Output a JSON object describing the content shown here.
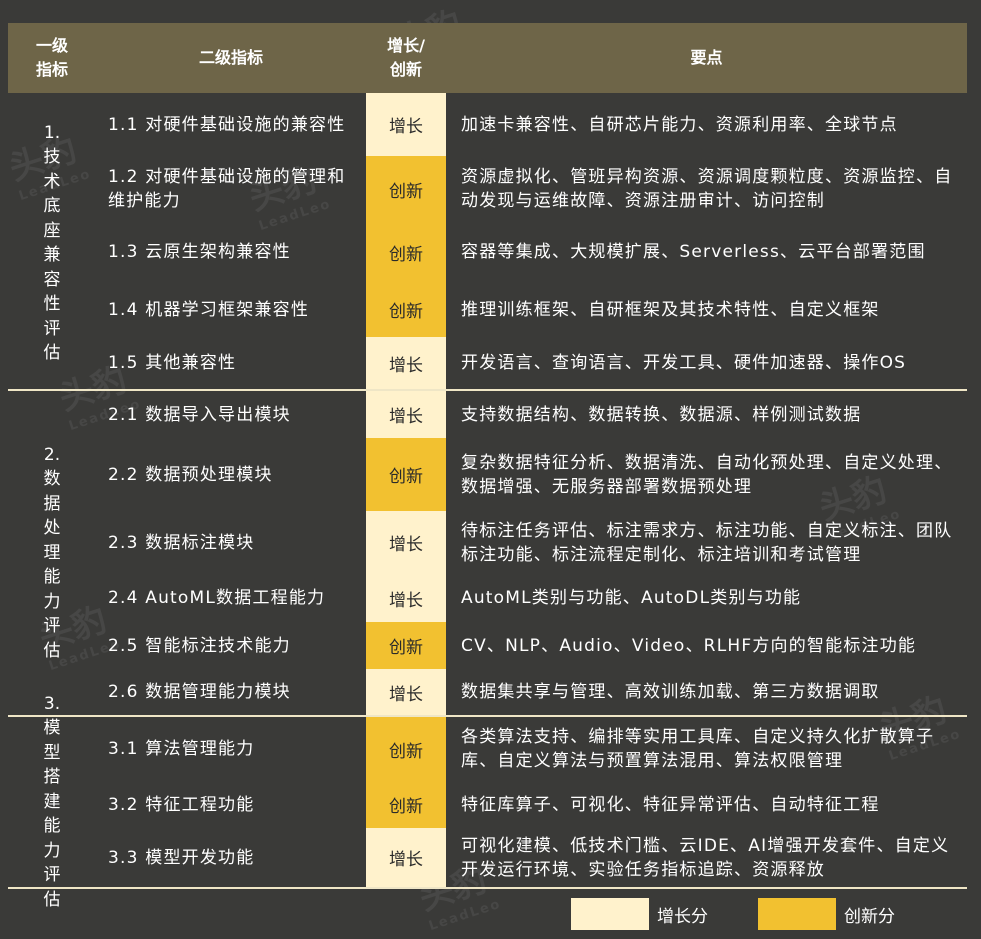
{
  "header": {
    "col1": "一级指标",
    "col2": "二级指标",
    "col3": "增长/创新",
    "col4": "要点"
  },
  "groups": [
    {
      "label": "1.技术底座兼容性评估",
      "rows": [
        {
          "l2": "1.1 对硬件基础设施的兼容性",
          "grade": "增长",
          "kp": "加速卡兼容性、自研芯片能力、资源利用率、全球节点"
        },
        {
          "l2": "1.2 对硬件基础设施的管理和维护能力",
          "grade": "创新",
          "kp": "资源虚拟化、管班异构资源、资源调度颗粒度、资源监控、自动发现与运维故障、资源注册审计、访问控制"
        },
        {
          "l2": "1.3 云原生架构兼容性",
          "grade": "创新",
          "kp": "容器等集成、大规模扩展、Serverless、云平台部署范围"
        },
        {
          "l2": "1.4 机器学习框架兼容性",
          "grade": "创新",
          "kp": "推理训练框架、自研框架及其技术特性、自定义框架"
        },
        {
          "l2": "1.5 其他兼容性",
          "grade": "增长",
          "kp": "开发语言、查询语言、开发工具、硬件加速器、操作OS"
        }
      ]
    },
    {
      "label": "2.数据处理能力评估",
      "rows": [
        {
          "l2": "2.1 数据导入导出模块",
          "grade": "增长",
          "kp": "支持数据结构、数据转换、数据源、样例测试数据"
        },
        {
          "l2": "2.2 数据预处理模块",
          "grade": "创新",
          "kp": "复杂数据特征分析、数据清洗、自动化预处理、自定义处理、数据增强、无服务器部署数据预处理"
        },
        {
          "l2": "2.3 数据标注模块",
          "grade": "增长",
          "kp": "待标注任务评估、标注需求方、标注功能、自定义标注、团队标注功能、标注流程定制化、标注培训和考试管理"
        },
        {
          "l2": "2.4 AutoML数据工程能力",
          "grade": "增长",
          "kp": "AutoML类别与功能、AutoDL类别与功能"
        },
        {
          "l2": "2.5 智能标注技术能力",
          "grade": "创新",
          "kp": "CV、NLP、Audio、Video、RLHF方向的智能标注功能"
        },
        {
          "l2": "2.6 数据管理能力模块",
          "grade": "增长",
          "kp": "数据集共享与管理、高效训练加载、第三方数据调取"
        }
      ]
    },
    {
      "label": "3.模型搭建能力评估",
      "rows": [
        {
          "l2": "3.1 算法管理能力",
          "grade": "创新",
          "kp": "各类算法支持、编排等实用工具库、自定义持久化扩散算子库、自定义算法与预置算法混用、算法权限管理"
        },
        {
          "l2": "3.2 特征工程功能",
          "grade": "创新",
          "kp": "特征库算子、可视化、特征异常评估、自动特征工程"
        },
        {
          "l2": "3.3 模型开发功能",
          "grade": "增长",
          "kp": "可视化建模、低技术门槛、云IDE、AI增强开发套件、自定义开发运行环境、实验任务指标追踪、资源释放"
        }
      ]
    }
  ],
  "legend": {
    "growth_label": "增长分",
    "innovation_label": "创新分"
  },
  "colors": {
    "growth": "#fff2cc",
    "innovation": "#f2c130",
    "header": "#6e6548",
    "background": "#3a3a38"
  }
}
